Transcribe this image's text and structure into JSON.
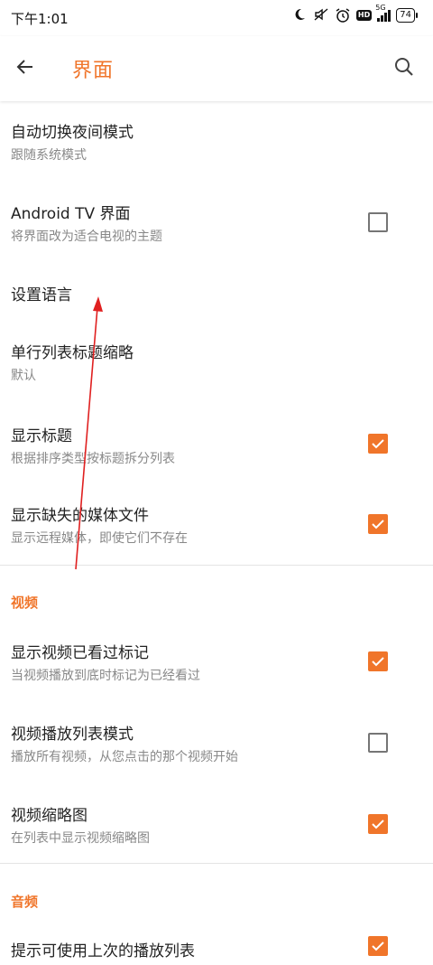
{
  "status_bar": {
    "time": "下午1:01",
    "network": "5G",
    "battery": "74"
  },
  "header": {
    "title": "界面"
  },
  "settings": [
    {
      "title": "自动切换夜间模式",
      "subtitle": "跟随系统模式",
      "checkbox": null
    },
    {
      "title": "Android TV 界面",
      "subtitle": "将界面改为适合电视的主题",
      "checkbox": false
    },
    {
      "title": "设置语言",
      "subtitle": "",
      "checkbox": null
    },
    {
      "title": "单行列表标题缩略",
      "subtitle": "默认",
      "checkbox": null
    },
    {
      "title": "显示标题",
      "subtitle": "根据排序类型按标题拆分列表",
      "checkbox": true
    },
    {
      "title": "显示缺失的媒体文件",
      "subtitle": "显示远程媒体，即使它们不存在",
      "checkbox": true
    }
  ],
  "video_section": {
    "header": "视频",
    "items": [
      {
        "title": "显示视频已看过标记",
        "subtitle": "当视频播放到底时标记为已经看过",
        "checkbox": true
      },
      {
        "title": "视频播放列表模式",
        "subtitle": "播放所有视频，从您点击的那个视频开始",
        "checkbox": false
      },
      {
        "title": "视频缩略图",
        "subtitle": "在列表中显示视频缩略图",
        "checkbox": true
      }
    ]
  },
  "audio_section": {
    "header": "音频",
    "items": [
      {
        "title": "提示可使用上次的播放列表",
        "subtitle": "",
        "checkbox": true
      }
    ]
  },
  "colors": {
    "accent": "#f0752a",
    "annotation_arrow": "#e02020"
  }
}
